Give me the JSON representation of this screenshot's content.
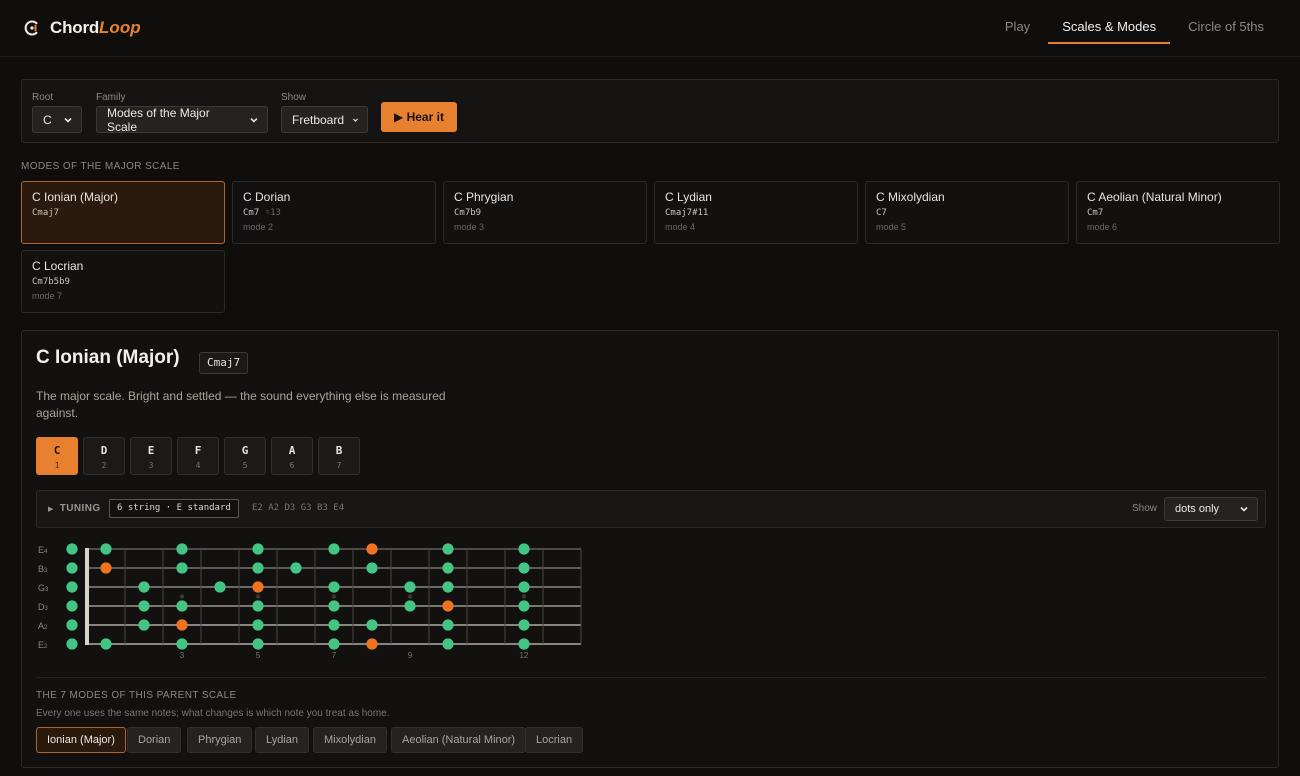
{
  "app": {
    "name_main": "Chord",
    "name_accent": "Loop"
  },
  "nav": [
    {
      "label": "Play",
      "active": false
    },
    {
      "label": "Scales & Modes",
      "active": true
    },
    {
      "label": "Circle of 5ths",
      "active": false
    }
  ],
  "controls": {
    "root_label": "Root",
    "root_value": "C",
    "family_label": "Family",
    "family_value": "Modes of the Major Scale",
    "show_label": "Show",
    "show_value": "Fretboard",
    "hear_button": "▶ Hear it"
  },
  "modes_section_label": "MODES OF THE MAJOR SCALE",
  "modes": [
    {
      "name": "C Ionian (Major)",
      "chord": "Cmaj7",
      "chord_extra": "",
      "num": "",
      "active": true
    },
    {
      "name": "C Dorian",
      "chord": "Cm7",
      "chord_extra": "♮13",
      "num": "mode 2",
      "active": false
    },
    {
      "name": "C Phrygian",
      "chord": "Cm7b9",
      "chord_extra": "",
      "num": "mode 3",
      "active": false
    },
    {
      "name": "C Lydian",
      "chord": "Cmaj7#11",
      "chord_extra": "",
      "num": "mode 4",
      "active": false
    },
    {
      "name": "C Mixolydian",
      "chord": "C7",
      "chord_extra": "",
      "num": "mode 5",
      "active": false
    },
    {
      "name": "C Aeolian (Natural Minor)",
      "chord": "Cm7",
      "chord_extra": "",
      "num": "mode 6",
      "active": false
    },
    {
      "name": "C Locrian",
      "chord": "Cm7b5b9",
      "chord_extra": "",
      "num": "mode 7",
      "active": false
    }
  ],
  "detail": {
    "title": "C Ionian (Major)",
    "chord": "Cmaj7",
    "description": "The major scale. Bright and settled — the sound everything else is measured against.",
    "notes": [
      {
        "letter": "C",
        "degree": "1",
        "active": true
      },
      {
        "letter": "D",
        "degree": "2",
        "active": false
      },
      {
        "letter": "E",
        "degree": "3",
        "active": false
      },
      {
        "letter": "F",
        "degree": "4",
        "active": false
      },
      {
        "letter": "G",
        "degree": "5",
        "active": false
      },
      {
        "letter": "A",
        "degree": "6",
        "active": false
      },
      {
        "letter": "B",
        "degree": "7",
        "active": false
      }
    ]
  },
  "tuning": {
    "label": "TUNING",
    "value": "6 string · E standard",
    "notes": "E2  A2  D3  G3  B3  E4",
    "show_label": "Show",
    "show_value": "dots only"
  },
  "fretboard": {
    "strings": [
      {
        "name": "E",
        "oct": "4"
      },
      {
        "name": "B",
        "oct": "3"
      },
      {
        "name": "G",
        "oct": "3"
      },
      {
        "name": "D",
        "oct": "3"
      },
      {
        "name": "A",
        "oct": "2"
      },
      {
        "name": "E",
        "oct": "2"
      }
    ],
    "fret_numbers": [
      "3",
      "5",
      "7",
      "9",
      "12"
    ],
    "fret_marker_positions": [
      3,
      5,
      7,
      9,
      12
    ],
    "frets": 12,
    "dots": [
      [
        0,
        0,
        0
      ],
      [
        0,
        1,
        0
      ],
      [
        0,
        3,
        0
      ],
      [
        0,
        5,
        0
      ],
      [
        0,
        7,
        0
      ],
      [
        0,
        8,
        1
      ],
      [
        0,
        10,
        0
      ],
      [
        0,
        12,
        0
      ],
      [
        1,
        0,
        0
      ],
      [
        1,
        1,
        1
      ],
      [
        1,
        3,
        0
      ],
      [
        1,
        5,
        0
      ],
      [
        1,
        6,
        0
      ],
      [
        1,
        8,
        0
      ],
      [
        1,
        10,
        0
      ],
      [
        1,
        12,
        0
      ],
      [
        2,
        0,
        0
      ],
      [
        2,
        2,
        0
      ],
      [
        2,
        4,
        0
      ],
      [
        2,
        5,
        1
      ],
      [
        2,
        7,
        0
      ],
      [
        2,
        9,
        0
      ],
      [
        2,
        10,
        0
      ],
      [
        2,
        12,
        0
      ],
      [
        3,
        0,
        0
      ],
      [
        3,
        2,
        0
      ],
      [
        3,
        3,
        0
      ],
      [
        3,
        5,
        0
      ],
      [
        3,
        7,
        0
      ],
      [
        3,
        9,
        0
      ],
      [
        3,
        10,
        1
      ],
      [
        3,
        12,
        0
      ],
      [
        4,
        0,
        0
      ],
      [
        4,
        2,
        0
      ],
      [
        4,
        3,
        1
      ],
      [
        4,
        5,
        0
      ],
      [
        4,
        7,
        0
      ],
      [
        4,
        8,
        0
      ],
      [
        4,
        10,
        0
      ],
      [
        4,
        12,
        0
      ],
      [
        5,
        0,
        0
      ],
      [
        5,
        1,
        0
      ],
      [
        5,
        3,
        0
      ],
      [
        5,
        5,
        0
      ],
      [
        5,
        7,
        0
      ],
      [
        5,
        8,
        1
      ],
      [
        5,
        10,
        0
      ],
      [
        5,
        12,
        0
      ]
    ]
  },
  "parent": {
    "label": "THE 7 MODES OF THIS PARENT SCALE",
    "sub": "Every one uses the same notes; what changes is which note you treat as home.",
    "pills": [
      {
        "label": "Ionian (Major)",
        "active": true
      },
      {
        "label": "Dorian",
        "active": false
      },
      {
        "label": "Phrygian",
        "active": false
      },
      {
        "label": "Lydian",
        "active": false
      },
      {
        "label": "Mixolydian",
        "active": false
      },
      {
        "label": "Aeolian (Natural Minor)",
        "active": false
      },
      {
        "label": "Locrian",
        "active": false
      }
    ]
  },
  "colors": {
    "accent": "#e8812f",
    "scale_dot": "#44c584",
    "root_dot": "#f07420"
  }
}
